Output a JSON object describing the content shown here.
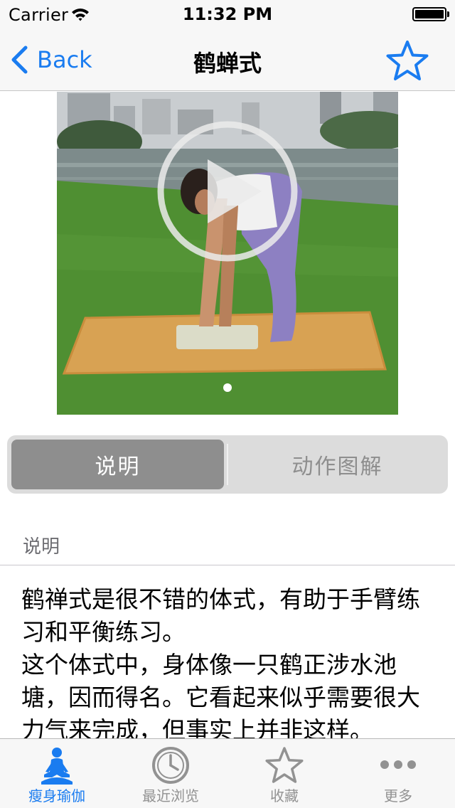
{
  "status_bar": {
    "carrier": "Carrier",
    "time": "11:32 PM"
  },
  "nav": {
    "back_label": "Back",
    "title": "鹤蝉式",
    "favorite_icon": "star-outline-icon"
  },
  "media": {
    "page_count": 1,
    "current_page": 1
  },
  "segmented": {
    "options": [
      "说明",
      "动作图解"
    ],
    "selected": "说明"
  },
  "section": {
    "header": "说明"
  },
  "description": {
    "paragraph1": "鹤禅式是很不错的体式，有助于手臂练习和平衡练习。",
    "paragraph2": "这个体式中，身体像一只鹤正涉水池塘，因而得名。它看起来似乎需要很大力气来完成，但事实上并非这样。"
  },
  "tabs": [
    {
      "label": "瘦身瑜伽",
      "icon": "meditation-icon",
      "active": true
    },
    {
      "label": "最近浏览",
      "icon": "clock-icon",
      "active": false
    },
    {
      "label": "收藏",
      "icon": "star-icon",
      "active": false
    },
    {
      "label": "更多",
      "icon": "more-icon",
      "active": false
    }
  ],
  "colors": {
    "accent": "#1a7cf0",
    "segment_active": "#8e8e8e",
    "inactive": "#929292"
  }
}
